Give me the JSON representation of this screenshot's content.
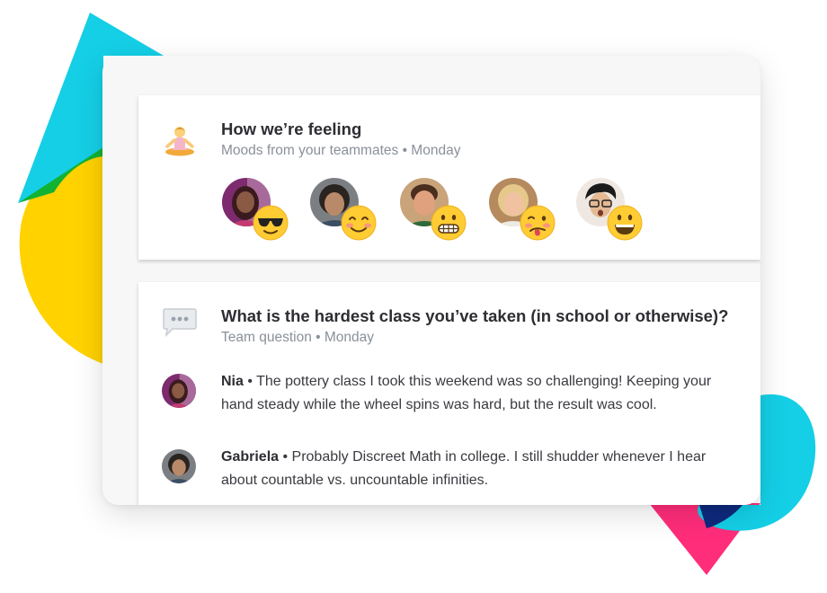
{
  "colors": {
    "cyan": "#14cfe6",
    "yellow": "#ffd200",
    "green": "#12b234",
    "pink": "#ff2d7a",
    "navy": "#0e2a7d",
    "title_text": "#2d2d33",
    "muted_text": "#8a9099"
  },
  "mood_panel": {
    "icon": "meditating-person-icon",
    "title": "How we’re feeling",
    "subtitle": "Moods from your teammates • Monday",
    "moods": [
      {
        "emoji": "sunglasses-emoji"
      },
      {
        "emoji": "smiling-blush-emoji"
      },
      {
        "emoji": "grimacing-emoji"
      },
      {
        "emoji": "woozy-face-emoji"
      },
      {
        "emoji": "grinning-emoji"
      }
    ]
  },
  "question_panel": {
    "icon": "speech-bubble-icon",
    "title": "What is the hardest class you’ve taken (in school or otherwise)?",
    "subtitle": "Team question • Monday",
    "answers": [
      {
        "name": "Nia",
        "separator": " • ",
        "text": "The pottery class I took this weekend was so challenging! Keeping your hand steady while the wheel spins was hard, but the result was cool."
      },
      {
        "name": "Gabriela",
        "separator": " • ",
        "text": "Probably Discreet Math in college. I still shudder whenever I hear about countable vs. uncountable infinities."
      }
    ]
  }
}
